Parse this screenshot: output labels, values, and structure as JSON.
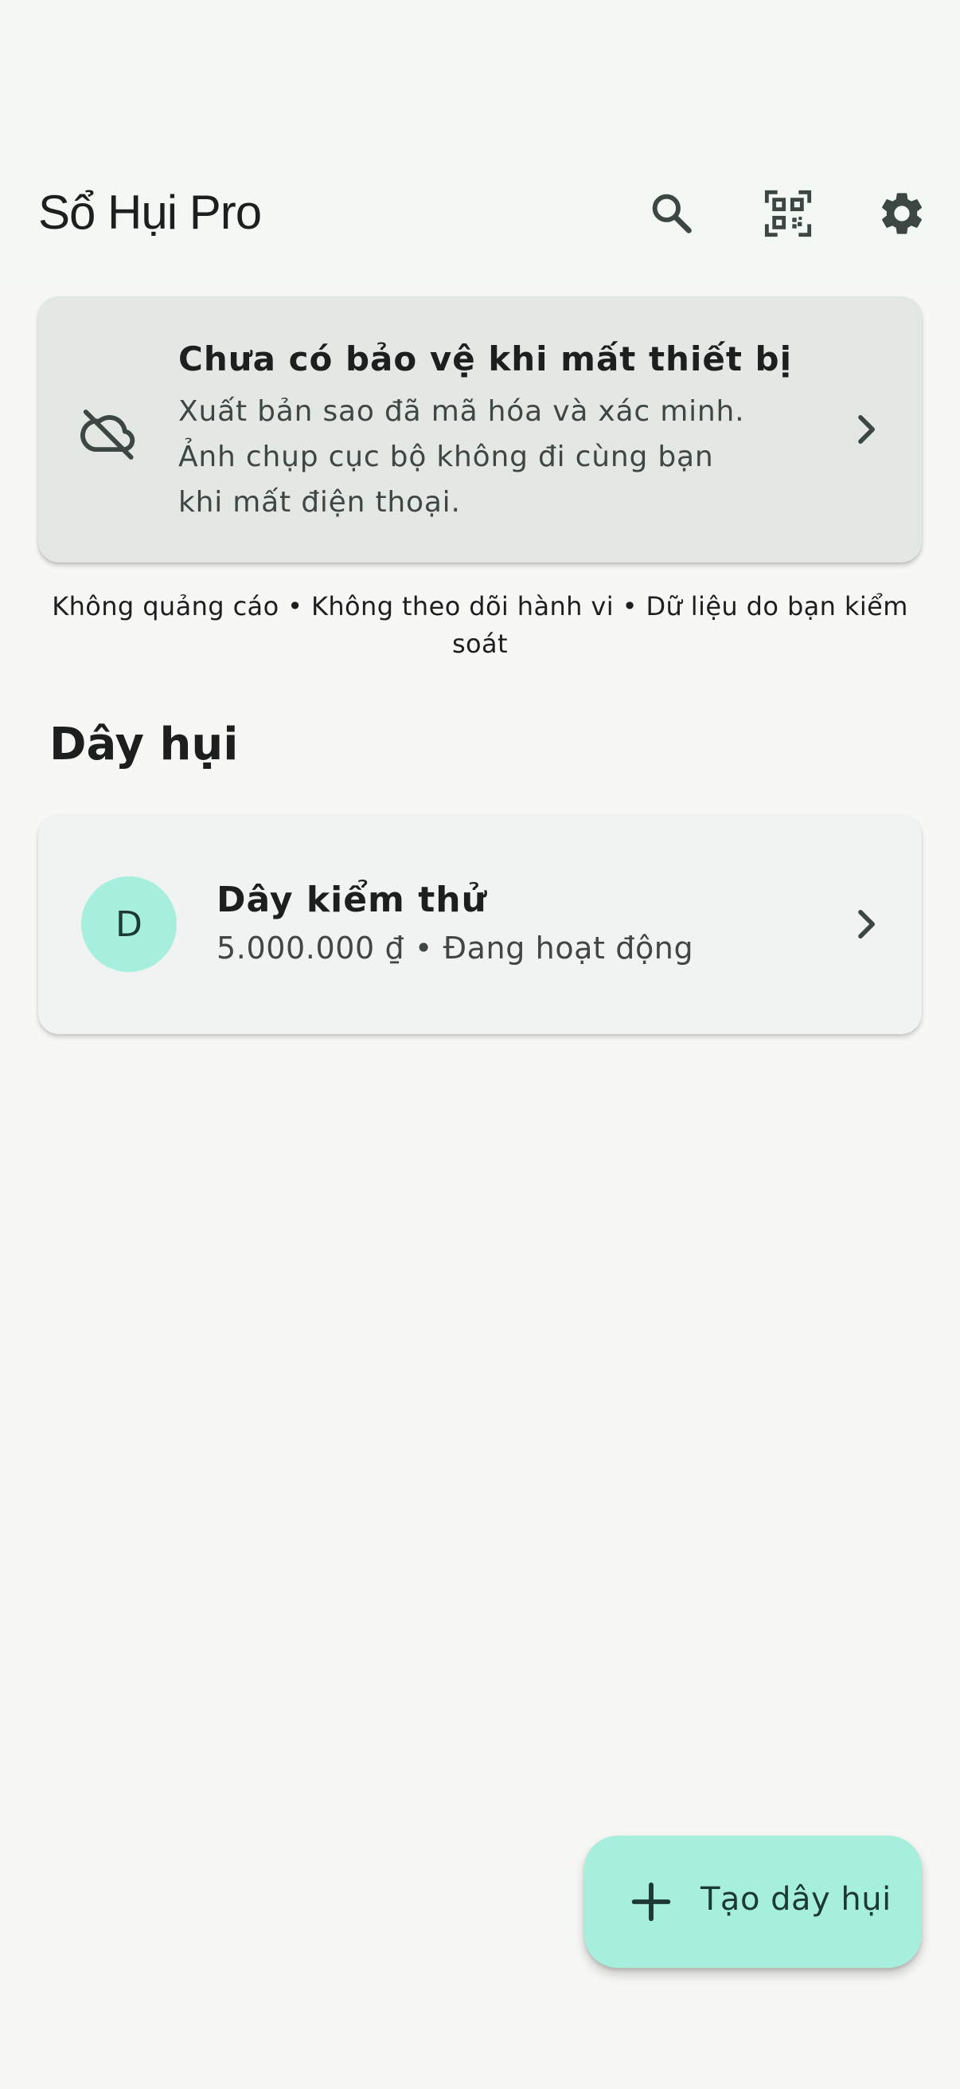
{
  "app_bar": {
    "title": "Sổ Hụi Pro",
    "actions": [
      "search-icon",
      "qr-code-icon",
      "settings-icon"
    ]
  },
  "backup_banner": {
    "icon": "cloud-off-icon",
    "title": "Chưa có bảo vệ khi mất thiết bị",
    "description_lines": [
      "Xuất bản sao đã mã hóa và xác minh.",
      "Ảnh chụp cục bộ không đi cùng bạn",
      "khi mất điện thoại."
    ]
  },
  "tagline_lines": [
    "Không quảng cáo • Không theo dõi hành vi • Dữ liệu do bạn kiểm",
    "soát"
  ],
  "section": {
    "title": "Dây hụi"
  },
  "groups": [
    {
      "avatar_letter": "D",
      "name": "Dây kiểm thử",
      "meta": "5.000.000 ₫ • Đang hoạt động"
    }
  ],
  "fab": {
    "icon": "plus-icon",
    "label": "Tạo dây hụi"
  },
  "colors": {
    "app_bar_bg": "#f3f8f5",
    "page_bg": "#f7f7f5",
    "accent": "#a6efdc",
    "banner_bg": "#e3e8e5"
  }
}
